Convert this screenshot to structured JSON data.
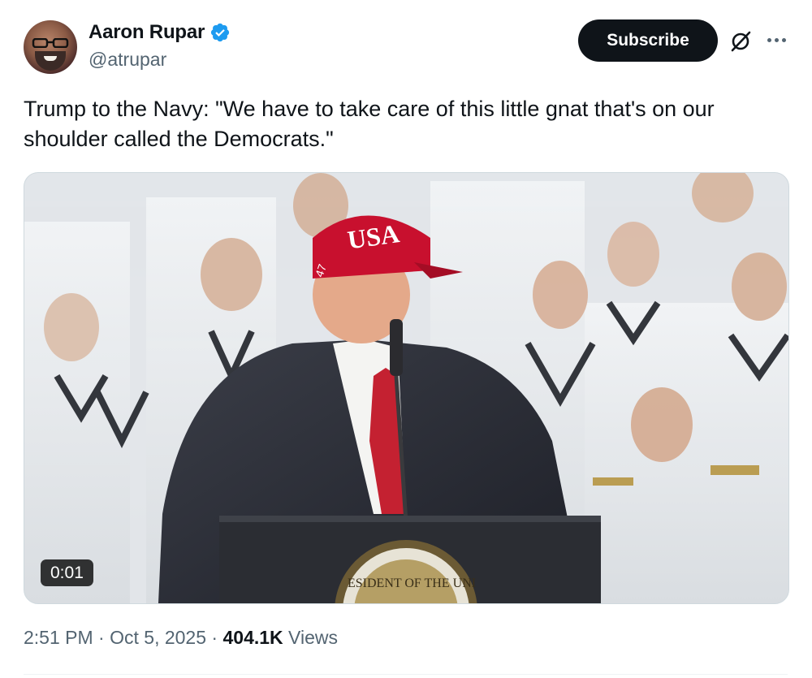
{
  "author": {
    "name": "Aaron Rupar",
    "handle": "@atrupar",
    "verified": true,
    "verified_color": "#1d9bf0"
  },
  "actions": {
    "subscribe_label": "Subscribe",
    "grok_icon": "grok-icon",
    "more_icon": "more-options-icon"
  },
  "tweet": {
    "text": "Trump to the Navy: \"We have to take care of this little gnat that's on our shoulder called the Democrats.\""
  },
  "media": {
    "type": "video",
    "duration": "0:01",
    "hat_text": "USA",
    "hat_side_text": "47",
    "seal_text": "ESIDENT OF THE UNI"
  },
  "meta": {
    "time": "2:51 PM",
    "separator": "·",
    "date": "Oct 5, 2025",
    "views_count": "404.1K",
    "views_label": "Views"
  },
  "colors": {
    "text_primary": "#0f1419",
    "text_secondary": "#536471",
    "hat_red": "#c8102e",
    "tie_red": "#c42131"
  }
}
